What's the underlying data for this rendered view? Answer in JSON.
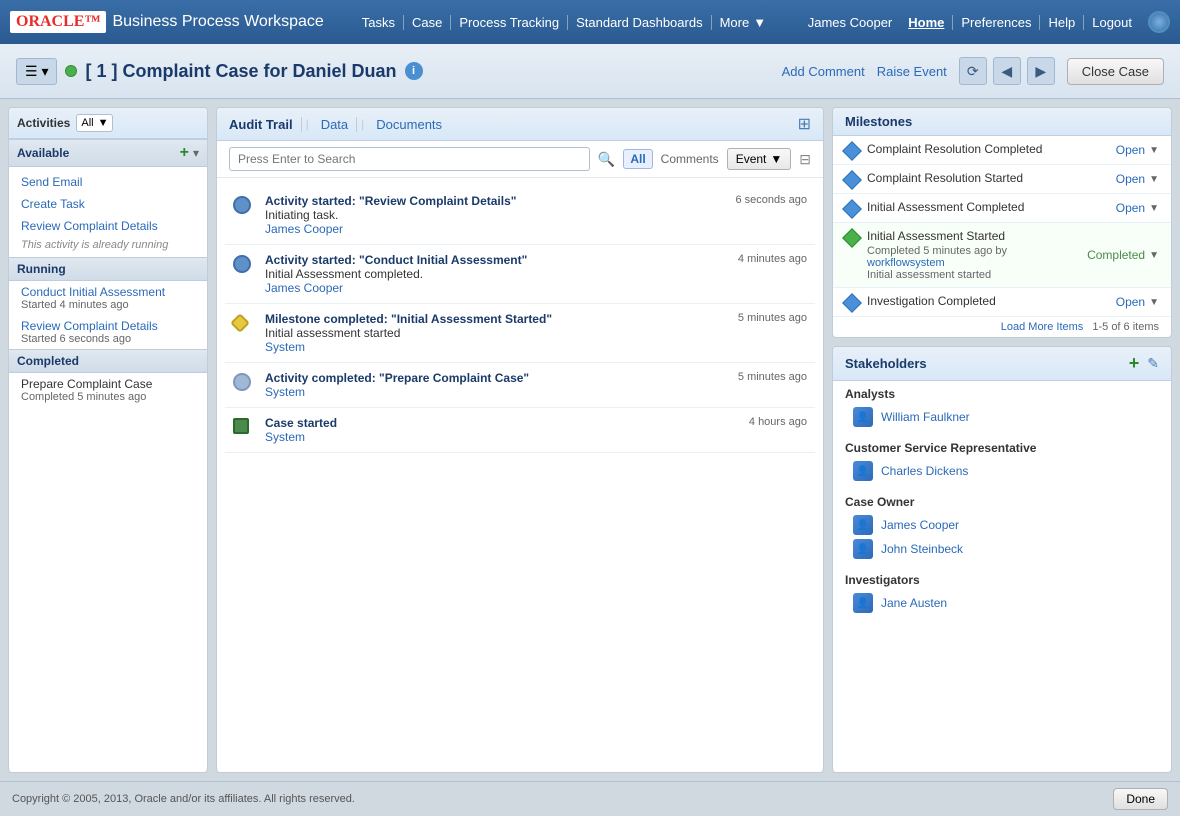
{
  "nav": {
    "logo": "ORACLE",
    "app_title": "Business Process Workspace",
    "links": [
      "Tasks",
      "Case",
      "Process Tracking",
      "Standard Dashboards"
    ],
    "more_label": "More",
    "user": "James Cooper",
    "home_label": "Home",
    "preferences_label": "Preferences",
    "help_label": "Help",
    "logout_label": "Logout"
  },
  "case_header": {
    "title": "[ 1 ] Complaint Case for Daniel Duan",
    "add_comment": "Add Comment",
    "raise_event": "Raise Event",
    "close_case": "Close Case"
  },
  "activities": {
    "label": "Activities",
    "filter": "All",
    "available_title": "Available",
    "items": [
      {
        "name": "Send Email"
      },
      {
        "name": "Create Task"
      },
      {
        "name": "Review Complaint Details",
        "note": "This activity is already running"
      }
    ],
    "running_title": "Running",
    "running_items": [
      {
        "name": "Conduct Initial Assessment",
        "time": "Started 4 minutes ago"
      },
      {
        "name": "Review Complaint Details",
        "time": "Started 6 seconds ago"
      }
    ],
    "completed_title": "Completed",
    "completed_items": [
      {
        "name": "Prepare Complaint Case",
        "time": "Completed 5 minutes ago"
      }
    ]
  },
  "audit_trail": {
    "tabs": [
      "Audit Trail",
      "Data",
      "Documents"
    ],
    "active_tab": "Audit Trail",
    "search_placeholder": "Press Enter to Search",
    "filter_all": "All",
    "filter_comments": "Comments",
    "event_label": "Event",
    "entries": [
      {
        "type": "activity",
        "title": "Activity started: \"Review Complaint Details\"",
        "detail": "Initiating task.",
        "user": "James Cooper",
        "time": "6 seconds ago"
      },
      {
        "type": "activity",
        "title": "Activity started: \"Conduct Initial Assessment\"",
        "detail": "Initial Assessment completed.",
        "user": "James Cooper",
        "time": "4 minutes ago"
      },
      {
        "type": "milestone",
        "title": "Milestone completed: \"Initial Assessment Started\"",
        "detail": "Initial assessment started",
        "user": "System",
        "time": "5 minutes ago"
      },
      {
        "type": "activity_complete",
        "title": "Activity completed: \"Prepare Complaint Case\"",
        "detail": "",
        "user": "System",
        "time": "5 minutes ago"
      },
      {
        "type": "case_started",
        "title": "Case started",
        "detail": "",
        "user": "System",
        "time": "4 hours ago"
      }
    ]
  },
  "milestones": {
    "title": "Milestones",
    "items": [
      {
        "name": "Complaint Resolution Completed",
        "status": "Open",
        "color": "blue"
      },
      {
        "name": "Complaint Resolution Started",
        "status": "Open",
        "color": "blue"
      },
      {
        "name": "Initial Assessment Completed",
        "status": "Open",
        "color": "blue"
      },
      {
        "name": "Initial Assessment Started",
        "status": "Completed",
        "color": "green",
        "detail1": "Completed 5 minutes ago by",
        "workflow_user": "workflowsystem",
        "detail2": "Initial assessment started"
      },
      {
        "name": "Investigation Completed",
        "status": "Open",
        "color": "blue"
      }
    ],
    "load_more": "Load More Items",
    "items_count": "1-5 of 6 items"
  },
  "stakeholders": {
    "title": "Stakeholders",
    "groups": [
      {
        "group_name": "Analysts",
        "people": [
          "William Faulkner"
        ]
      },
      {
        "group_name": "Customer Service Representative",
        "people": [
          "Charles Dickens"
        ]
      },
      {
        "group_name": "Case Owner",
        "people": [
          "James Cooper",
          "John Steinbeck"
        ]
      },
      {
        "group_name": "Investigators",
        "people": [
          "Jane Austen"
        ]
      }
    ]
  },
  "footer": {
    "copyright": "Copyright © 2005, 2013, Oracle and/or its affiliates. All rights reserved.",
    "done_label": "Done"
  }
}
